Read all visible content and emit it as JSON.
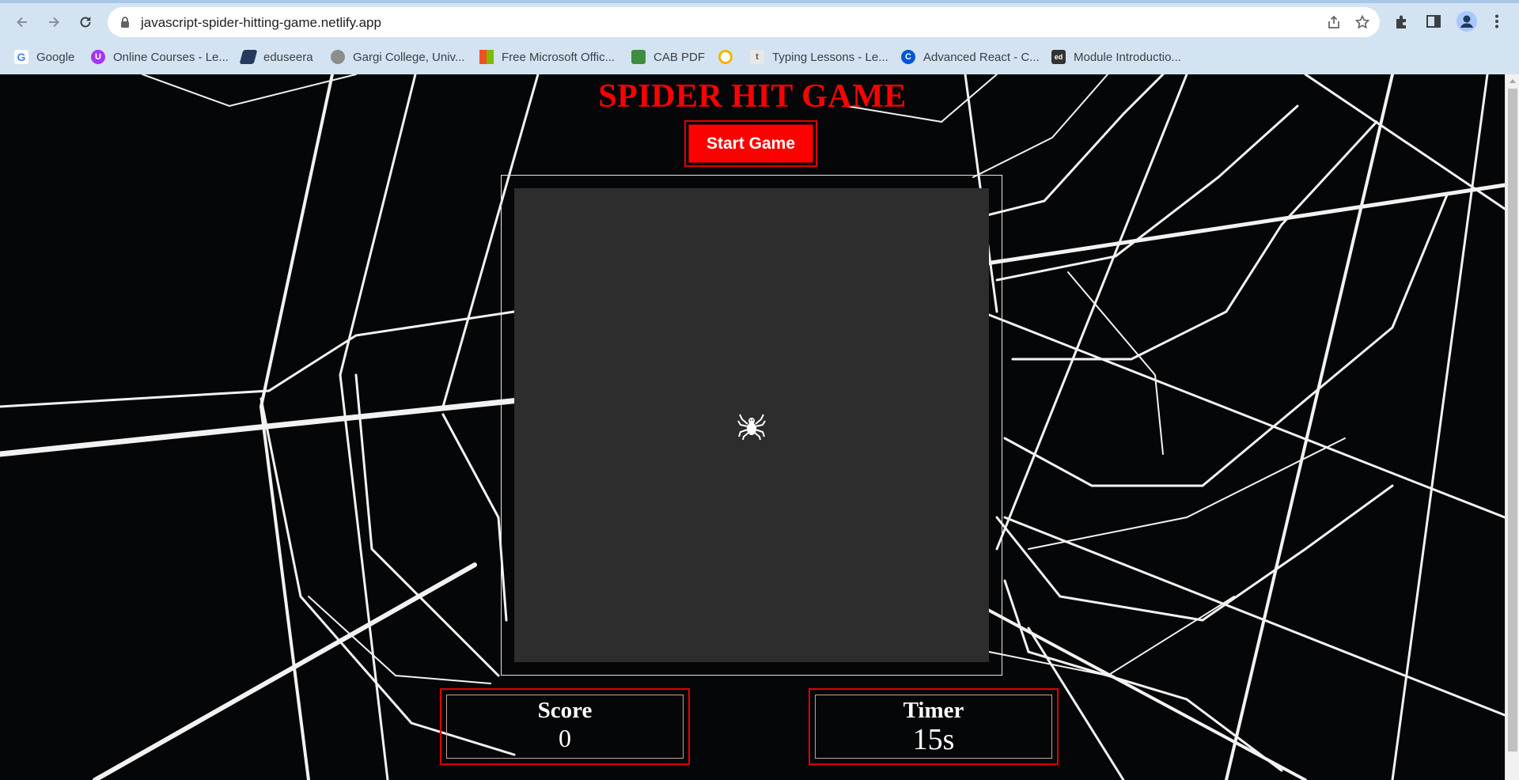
{
  "browser": {
    "url": "javascript-spider-hitting-game.netlify.app",
    "bookmarks": [
      {
        "label": "Google",
        "icon": "google-icon"
      },
      {
        "label": "Online Courses - Le...",
        "icon": "udemy-icon"
      },
      {
        "label": "eduseera",
        "icon": "eduseera-icon"
      },
      {
        "label": "Gargi College, Univ...",
        "icon": "college-crest-icon"
      },
      {
        "label": "Free Microsoft Offic...",
        "icon": "microsoft-icon"
      },
      {
        "label": "CAB PDF",
        "icon": "pdf-icon"
      },
      {
        "label": "",
        "icon": "chrome-web-store-icon"
      },
      {
        "label": "Typing Lessons - Le...",
        "icon": "typing-icon"
      },
      {
        "label": "Advanced React - C...",
        "icon": "coursera-icon"
      },
      {
        "label": "Module Introductio...",
        "icon": "course-icon"
      }
    ]
  },
  "game": {
    "title": "SPIDER HIT GAME",
    "start_label": "Start Game",
    "score_label": "Score",
    "score_value": "0",
    "timer_label": "Timer",
    "timer_value": "15s",
    "colors": {
      "accent": "#ff0000",
      "board": "#2d2d2d",
      "background": "#050608"
    }
  }
}
